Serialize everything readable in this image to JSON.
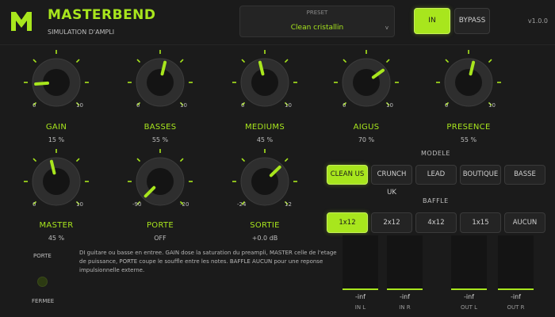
{
  "app": {
    "logo": "M",
    "title": "MASTERBEND",
    "subtitle": "SIMULATION D'AMPLI",
    "version": "v1.0.0"
  },
  "preset": {
    "label": "PRESET",
    "value": "Clean cristallin",
    "caret": "v"
  },
  "header_buttons": {
    "in": "IN",
    "bypass": "BYPASS"
  },
  "knobs": [
    {
      "id": "gain",
      "label": "GAIN",
      "value": "15 %",
      "min": "0",
      "max": "10",
      "level": 0.15
    },
    {
      "id": "basses",
      "label": "BASSES",
      "value": "55 %",
      "min": "0",
      "max": "10",
      "level": 0.55
    },
    {
      "id": "mediums",
      "label": "MEDIUMS",
      "value": "45 %",
      "min": "0",
      "max": "10",
      "level": 0.45
    },
    {
      "id": "aigus",
      "label": "AIGUS",
      "value": "70 %",
      "min": "0",
      "max": "10",
      "level": 0.7
    },
    {
      "id": "presence",
      "label": "PRESENCE",
      "value": "55 %",
      "min": "0",
      "max": "10",
      "level": 0.55
    },
    {
      "id": "master",
      "label": "MASTER",
      "value": "45 %",
      "min": "0",
      "max": "10",
      "level": 0.45
    },
    {
      "id": "porte",
      "label": "PORTE",
      "value": "OFF",
      "min": "-90",
      "max": "-20",
      "level": 0.0
    },
    {
      "id": "sortie",
      "label": "SORTIE",
      "value": "+0.0 dB",
      "min": "-24",
      "max": "12",
      "level": 0.67
    }
  ],
  "modele": {
    "title": "MODELE",
    "options": [
      "CLEAN US",
      "CRUNCH UK",
      "LEAD",
      "BOUTIQUE",
      "BASSE"
    ],
    "selected": 0
  },
  "baffle": {
    "title": "BAFFLE",
    "options": [
      "1x12",
      "2x12",
      "4x12",
      "1x15",
      "AUCUN"
    ],
    "selected": 0
  },
  "gate_indicator": {
    "title": "PORTE",
    "state": "FERMEE"
  },
  "info": "DI guitare ou basse en entree. GAIN dose la saturation du preampli, MASTER celle de l'etage de puissance, PORTE coupe le souffle entre les notes. BAFFLE AUCUN pour une reponse impulsionnelle externe.",
  "meters": [
    {
      "label": "IN L",
      "value": "-inf",
      "level": 0.0
    },
    {
      "label": "IN R",
      "value": "-inf",
      "level": 0.0
    },
    {
      "label": "OUT L",
      "value": "-inf",
      "level": 0.0
    },
    {
      "label": "OUT R",
      "value": "-inf",
      "level": 0.0
    }
  ],
  "colors": {
    "accent": "#a8e61d",
    "background": "#1b1b1b",
    "panel": "#242424"
  }
}
